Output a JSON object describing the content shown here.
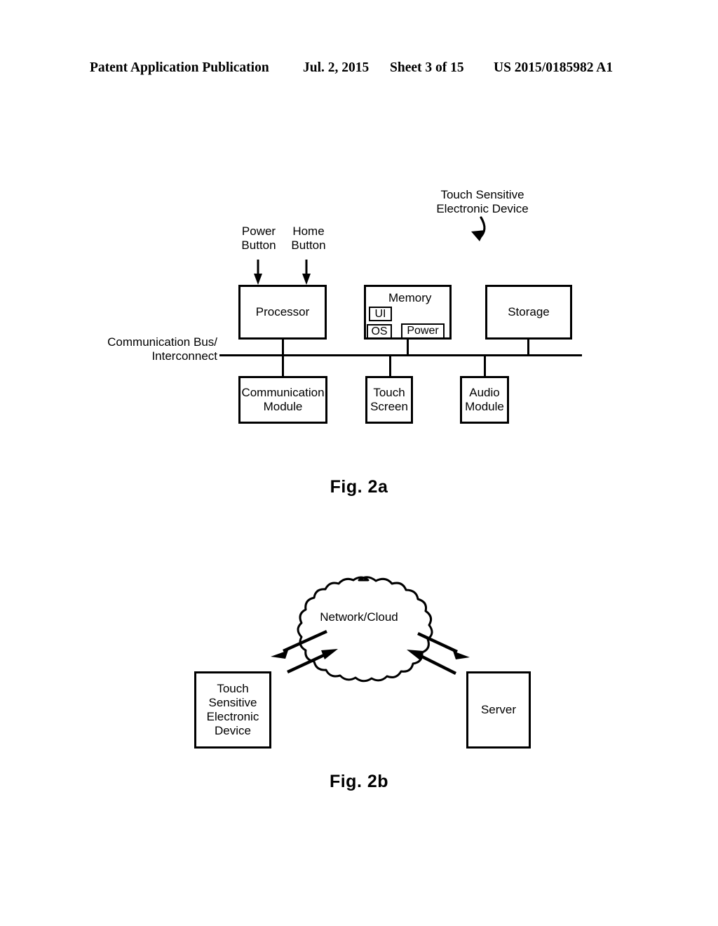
{
  "header": {
    "publication": "Patent Application Publication",
    "date": "Jul. 2, 2015",
    "sheet": "Sheet 3 of 15",
    "patent_number": "US 2015/0185982 A1"
  },
  "figures": [
    {
      "id": "fig2a",
      "caption": "Fig. 2a",
      "callouts": {
        "power_button": "Power\nButton",
        "home_button": "Home\nButton",
        "touch_sensitive_device": "Touch Sensitive\nElectronic Device",
        "bus_label": "Communication Bus/\nInterconnect"
      },
      "top_blocks": [
        {
          "name": "processor",
          "label": "Processor"
        },
        {
          "name": "memory",
          "label": "Memory"
        },
        {
          "name": "storage",
          "label": "Storage"
        }
      ],
      "memory_contents": [
        {
          "name": "ui",
          "label": "UI"
        },
        {
          "name": "os",
          "label": "OS"
        },
        {
          "name": "power",
          "label": "Power"
        }
      ],
      "bottom_blocks": [
        {
          "name": "communication-module",
          "label": "Communication\nModule"
        },
        {
          "name": "touch-screen",
          "label": "Touch\nScreen"
        },
        {
          "name": "audio-module",
          "label": "Audio\nModule"
        }
      ]
    },
    {
      "id": "fig2b",
      "caption": "Fig. 2b",
      "cloud_label": "Network/Cloud",
      "nodes": [
        {
          "name": "touch-sensitive-electronic-device",
          "label": "Touch Sensitive\nElectronic Device"
        },
        {
          "name": "server",
          "label": "Server"
        }
      ]
    }
  ],
  "colors": {
    "ink": "#000000",
    "paper": "#ffffff"
  }
}
